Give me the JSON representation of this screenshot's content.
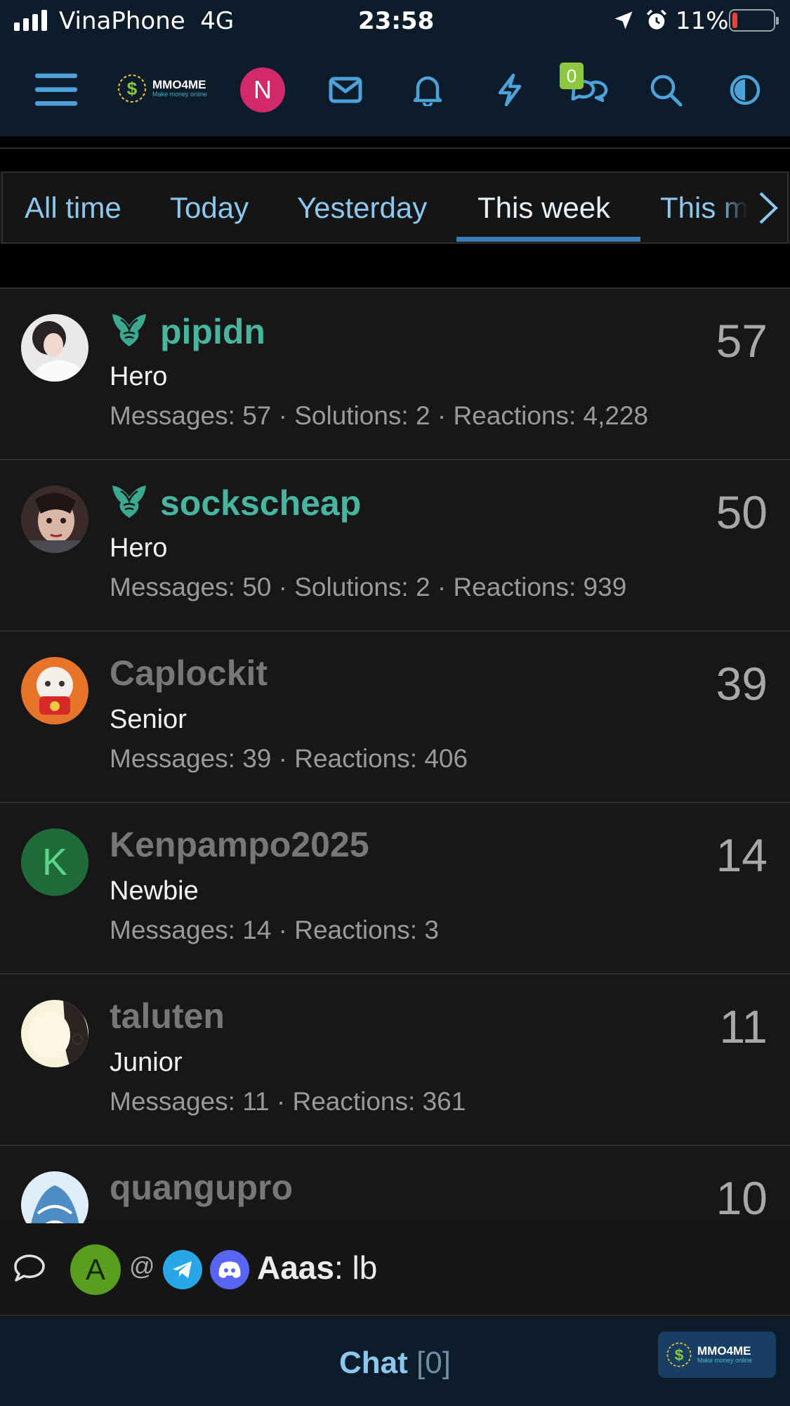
{
  "status_bar": {
    "carrier": "VinaPhone",
    "network": "4G",
    "time": "23:58",
    "battery": "11%"
  },
  "nav": {
    "logo_text": "MMO4ME",
    "logo_tagline": "Make money online",
    "avatar_letter": "N",
    "avatar_color": "#d3296a",
    "conversations_badge": "0",
    "icons": [
      "menu-icon",
      "envelope-icon",
      "bell-icon",
      "lightning-icon",
      "conversations-icon",
      "search-icon",
      "theme-toggle-icon"
    ]
  },
  "tabs": {
    "items": [
      {
        "label": "All time"
      },
      {
        "label": "Today"
      },
      {
        "label": "Yesterday"
      },
      {
        "label": "This week"
      },
      {
        "label": "This month"
      }
    ],
    "active": "This week"
  },
  "members": [
    {
      "name": "pipidn",
      "title": "Hero",
      "stats": "Messages: 57 · Solutions: 2 · Reactions: 4,228",
      "count": "57",
      "hero_badge": true
    },
    {
      "name": "sockscheap",
      "title": "Hero",
      "stats": "Messages: 50 · Solutions: 2 · Reactions: 939",
      "count": "50",
      "hero_badge": true
    },
    {
      "name": "Caplockit",
      "title": "Senior",
      "stats": "Messages: 39 · Reactions: 406",
      "count": "39",
      "hero_badge": false
    },
    {
      "name": "Kenpampo2025",
      "title": "Newbie",
      "stats": "Messages: 14 · Reactions: 3",
      "count": "14",
      "hero_badge": false,
      "avatar_letter": "K"
    },
    {
      "name": "taluten",
      "title": "Junior",
      "stats": "Messages: 11 · Reactions: 361",
      "count": "11",
      "hero_badge": false
    },
    {
      "name": "quangupro",
      "title": "",
      "stats": "",
      "count": "10",
      "hero_badge": false
    }
  ],
  "shoutbox": {
    "avatar_letter": "A",
    "at_symbol": "@",
    "author": "Aaas",
    "separator": ": ",
    "message": "lb"
  },
  "chat_footer": {
    "label": "Chat",
    "count": "[0]",
    "logo_text": "MMO4ME",
    "logo_tagline": "Make money online"
  },
  "colors": {
    "nav_bg": "#0c1c2b",
    "accent_blue": "#8cc8ee",
    "hero_green": "#47b59f",
    "tab_underline": "#3a7cb3"
  }
}
